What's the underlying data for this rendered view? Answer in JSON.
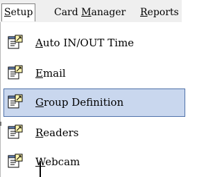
{
  "menubar": {
    "items": [
      {
        "label_u": "S",
        "label_rest": "etup"
      },
      {
        "label_pre": "Card ",
        "label_u": "M",
        "label_rest": "anager"
      },
      {
        "label_u": "R",
        "label_rest": "eports"
      }
    ]
  },
  "setup_menu": {
    "items": [
      {
        "label_u": "A",
        "label_rest": "uto IN/OUT Time",
        "icon": "properties-icon"
      },
      {
        "label_u": "E",
        "label_rest": "mail",
        "icon": "properties-icon"
      },
      {
        "label_u": "G",
        "label_rest": "roup Definition",
        "icon": "properties-icon",
        "selected": true
      },
      {
        "label_u": "R",
        "label_rest": "eaders",
        "icon": "properties-icon"
      },
      {
        "label_u": "W",
        "label_rest": "ebcam",
        "icon": "properties-icon"
      }
    ]
  },
  "colors": {
    "highlight_bg": "#c9d7ee",
    "highlight_border": "#4d6fa8",
    "menubar_bg": "#efefef"
  }
}
